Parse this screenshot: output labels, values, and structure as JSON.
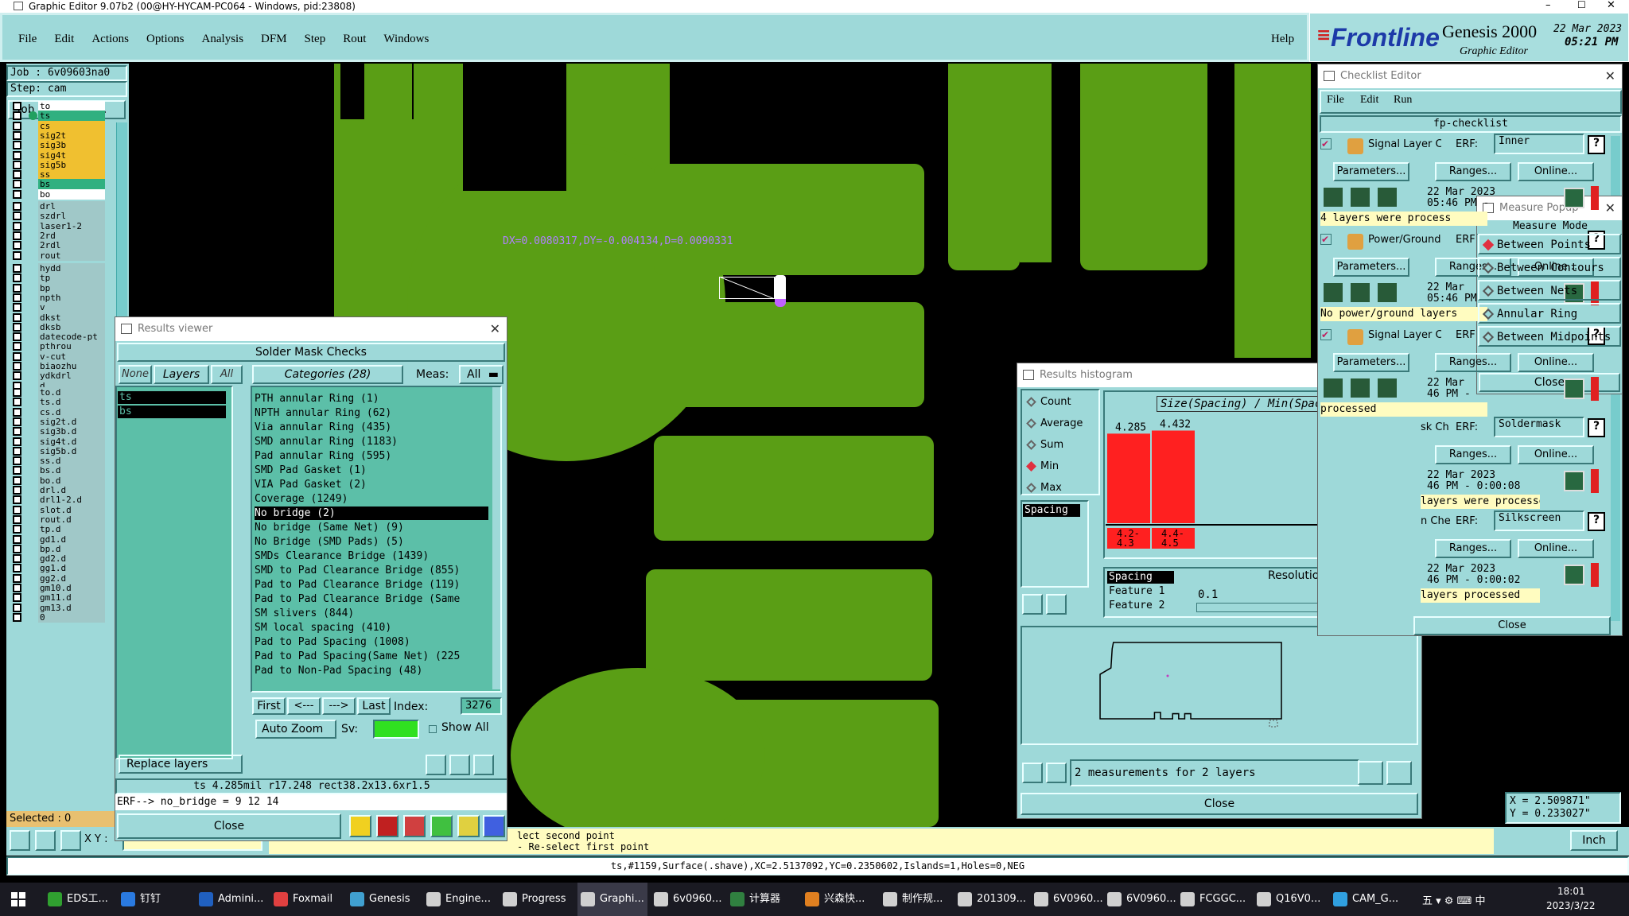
{
  "titlebar": {
    "title": "Graphic Editor 9.07b2 (00@HY-HYCAM-PC064 - Windows, pid:23808)",
    "min": "–",
    "max": "☐",
    "close": "✕"
  },
  "menubar": {
    "items": [
      "File",
      "Edit",
      "Actions",
      "Options",
      "Analysis",
      "DFM",
      "Step",
      "Rout",
      "Windows"
    ],
    "help": "Help"
  },
  "brand": {
    "logo": "Frontline",
    "product": "Genesis 2000",
    "subtitle": "Graphic Editor",
    "date": "22 Mar 2023",
    "time": "05:21 PM"
  },
  "job": {
    "job": "Job : 6v09603na0",
    "step": "Step: cam",
    "matrix": "Job Matrix ..."
  },
  "layers": [
    {
      "n": "to",
      "c": "#ffffff"
    },
    {
      "n": "ts",
      "c": "#30b080"
    },
    {
      "n": "cs",
      "c": "#f0c030"
    },
    {
      "n": "sig2t",
      "c": "#f0c030"
    },
    {
      "n": "sig3b",
      "c": "#f0c030"
    },
    {
      "n": "sig4t",
      "c": "#f0c030"
    },
    {
      "n": "sig5b",
      "c": "#f0c030"
    },
    {
      "n": "ss",
      "c": "#f0c030"
    },
    {
      "n": "bs",
      "c": "#30b080"
    },
    {
      "n": "bo",
      "c": "#ffffff"
    },
    {
      "n": "drl",
      "c": "#a0c8c8"
    },
    {
      "n": "szdrl",
      "c": "#a0c8c8"
    },
    {
      "n": "laser1-2",
      "c": "#a0c8c8"
    },
    {
      "n": "2rd",
      "c": "#a0c8c8"
    },
    {
      "n": "2rdl",
      "c": "#a0c8c8"
    },
    {
      "n": "rout",
      "c": "#a0c8c8"
    },
    {
      "n": "hydd",
      "c": "#a0c8c8"
    },
    {
      "n": "tp",
      "c": "#a0c8c8"
    },
    {
      "n": "bp",
      "c": "#a0c8c8"
    },
    {
      "n": "npth",
      "c": "#a0c8c8"
    },
    {
      "n": "v",
      "c": "#a0c8c8"
    },
    {
      "n": "dkst",
      "c": "#a0c8c8"
    },
    {
      "n": "dksb",
      "c": "#a0c8c8"
    },
    {
      "n": "datecode-pt",
      "c": "#a0c8c8"
    },
    {
      "n": "pthrou",
      "c": "#a0c8c8"
    },
    {
      "n": "v-cut",
      "c": "#a0c8c8"
    },
    {
      "n": "biaozhu",
      "c": "#a0c8c8"
    },
    {
      "n": "ydkdrl",
      "c": "#a0c8c8"
    },
    {
      "n": "d",
      "c": "#a0c8c8"
    },
    {
      "n": "to.d",
      "c": "#a0c8c8"
    },
    {
      "n": "ts.d",
      "c": "#a0c8c8"
    },
    {
      "n": "cs.d",
      "c": "#a0c8c8"
    },
    {
      "n": "sig2t.d",
      "c": "#a0c8c8"
    },
    {
      "n": "sig3b.d",
      "c": "#a0c8c8"
    },
    {
      "n": "sig4t.d",
      "c": "#a0c8c8"
    },
    {
      "n": "sig5b.d",
      "c": "#a0c8c8"
    },
    {
      "n": "ss.d",
      "c": "#a0c8c8"
    },
    {
      "n": "bs.d",
      "c": "#a0c8c8"
    },
    {
      "n": "bo.d",
      "c": "#a0c8c8"
    },
    {
      "n": "drl.d",
      "c": "#a0c8c8"
    },
    {
      "n": "drl1-2.d",
      "c": "#a0c8c8"
    },
    {
      "n": "slot.d",
      "c": "#a0c8c8"
    },
    {
      "n": "rout.d",
      "c": "#a0c8c8"
    },
    {
      "n": "tp.d",
      "c": "#a0c8c8"
    },
    {
      "n": "gd1.d",
      "c": "#a0c8c8"
    },
    {
      "n": "bp.d",
      "c": "#a0c8c8"
    },
    {
      "n": "gd2.d",
      "c": "#a0c8c8"
    },
    {
      "n": "gg1.d",
      "c": "#a0c8c8"
    },
    {
      "n": "gg2.d",
      "c": "#a0c8c8"
    },
    {
      "n": "gm10.d",
      "c": "#a0c8c8"
    },
    {
      "n": "gm11.d",
      "c": "#a0c8c8"
    },
    {
      "n": "gm13.d",
      "c": "#a0c8c8"
    },
    {
      "n": "0",
      "c": "#a0c8c8"
    }
  ],
  "selected": "Selected : 0",
  "measure_text": "DX=0.0080317,DY=-0.004134,D=0.0090331",
  "results_viewer": {
    "title": "Results viewer",
    "heading": "Solder Mask Checks",
    "none": "None",
    "layers": "Layers",
    "all": "All",
    "categories_btn": "Categories (28)",
    "meas_label": "Meas:",
    "meas_value": "All",
    "layer_list": [
      "ts",
      "bs"
    ],
    "categories": [
      "PTH annular Ring (1)",
      "NPTH annular Ring (62)",
      "Via annular Ring (435)",
      "SMD annular Ring (1183)",
      "Pad annular Ring (595)",
      "SMD Pad Gasket (1)",
      "VIA Pad Gasket (2)",
      "Coverage (1249)",
      "No bridge (2)",
      "No bridge (Same Net) (9)",
      "No Bridge (SMD Pads) (5)",
      "SMDs Clearance Bridge (1439)",
      "SMD to Pad Clearance Bridge (855)",
      "Pad to Pad Clearance Bridge (119)",
      "Pad to Pad Clearance Bridge (Same",
      "SM slivers (844)",
      "SM local spacing (410)",
      "Pad to Pad Spacing (1008)",
      "Pad to Pad Spacing(Same Net) (225",
      "Pad to Non-Pad Spacing (48)"
    ],
    "selected_index": 8,
    "first": "First",
    "prev": "<---",
    "next": "--->",
    "last": "Last",
    "index_label": "Index:",
    "index_value": "3276",
    "autozoom": "Auto Zoom",
    "sv": "Sv:",
    "show_all": "Show All",
    "replace": "Replace layers",
    "status": "ts 4.285mil  r17.248  rect38.2x13.6xr1.5",
    "erf": "ERF--> no_bridge = 9 12 14",
    "close": "Close"
  },
  "histogram": {
    "title": "Results histogram",
    "options": [
      "Count",
      "Average",
      "Sum",
      "Min",
      "Max"
    ],
    "selected": "Min",
    "list": [
      "Spacing"
    ],
    "chart_title": "Size(Spacing) / Min(Spacing)",
    "fields": [
      "Spacing",
      "Feature 1",
      "Feature 2"
    ],
    "resolution_label": "Resolution",
    "resolution": "0.1",
    "measurements": "2 measurements for 2 layers",
    "close": "Close"
  },
  "chart_data": {
    "type": "bar",
    "title": "Size(Spacing) / Min(Spacing)",
    "categories": [
      "4.2-4.3",
      "4.4-4.5"
    ],
    "values": [
      4.285,
      4.432
    ],
    "value_labels": [
      "4.285",
      "4.432"
    ],
    "category_labels": [
      [
        "4.2-",
        "4.3"
      ],
      [
        "4.4-",
        "4.5"
      ]
    ],
    "color": "#ff2020"
  },
  "checklist": {
    "title": "Checklist Editor",
    "menu": [
      "File",
      "Edit",
      "Run"
    ],
    "name": "fp-checklist",
    "rows": [
      {
        "name": "Signal Layer Ch",
        "erf": "ERF:",
        "value": "Inner",
        "date": "22 Mar 2023",
        "time": "05:46 PM -",
        "status": "4 layers were process"
      },
      {
        "name": "Power/Ground C",
        "erf": "ERF",
        "value": "",
        "date": "22 Mar",
        "time": "05:46 PM",
        "status": "No power/ground layers"
      },
      {
        "name": "Signal Layer Ch",
        "erf": "ERF",
        "value": "",
        "date": "22 Mar",
        "time": "46 PM -",
        "status": "processed"
      },
      {
        "name": "sk Ch",
        "erf": "ERF:",
        "value": "Soldermask",
        "date": "22 Mar 2023",
        "time": "46 PM - 0:00:08",
        "status": "layers were processed"
      },
      {
        "name": "n Che",
        "erf": "ERF:",
        "value": "Silkscreen",
        "date": "22 Mar 2023",
        "time": "46 PM - 0:00:02",
        "status": "layers processed"
      }
    ],
    "params": "Parameters...",
    "ranges": "Ranges...",
    "online": "Online...",
    "close": "Close"
  },
  "measure_popup": {
    "title": "Measure Popup",
    "header": "Measure Mode",
    "modes": [
      "Between Points",
      "Between Contours",
      "Between Nets",
      "Annular Ring",
      "Between Midpoints"
    ],
    "selected": 0,
    "close": "Close"
  },
  "coords": {
    "x": "X = 2.509871\"",
    "y": "Y = 0.233027\""
  },
  "units": "Inch",
  "prompt": {
    "line1": "lect second point",
    "line2": "- Re-select first point",
    "xy": "X Y :"
  },
  "statusline": "ts,#1159,Surface(.shave),XC=2.5137092,YC=0.2350602,Islands=1,Holes=0,NEG",
  "taskbar": {
    "items": [
      "EDS工...",
      "钉钉",
      "Admini...",
      "Foxmail",
      "Genesis",
      "Engine...",
      "Progress",
      "Graphi...",
      "6v0960...",
      "计算器",
      "兴森快...",
      "制作规...",
      "201309...",
      "6V0960...",
      "6V0960...",
      "FCGGC...",
      "Q16V0...",
      "CAM_G..."
    ],
    "time": "18:01",
    "date": "2023/3/22",
    "tray": "五 ▾ ⚙ ⌨ 中"
  }
}
